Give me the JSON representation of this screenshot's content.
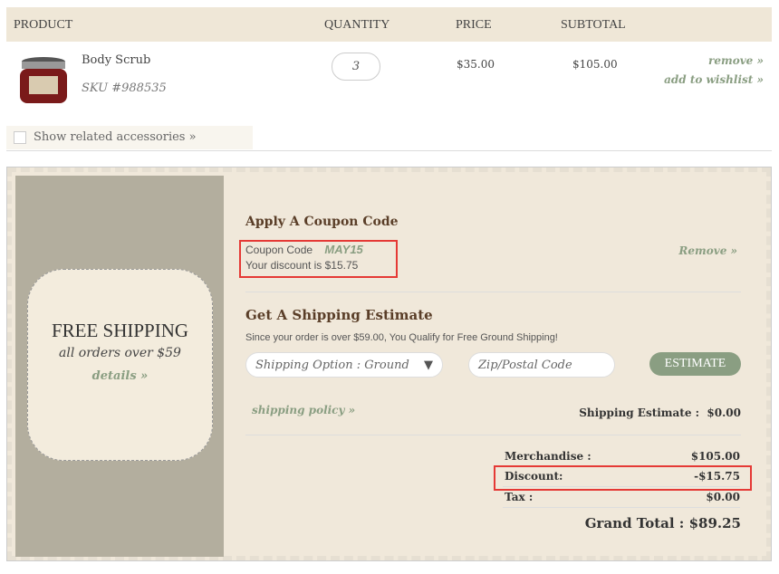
{
  "table": {
    "headers": {
      "product": "PRODUCT",
      "quantity": "QUANTITY",
      "price": "PRICE",
      "subtotal": "SUBTOTAL"
    }
  },
  "item": {
    "name": "Body Scrub",
    "sku": "SKU #988535",
    "quantity": "3",
    "price": "$35.00",
    "subtotal": "$105.00",
    "remove": "remove »",
    "wishlist": "add to wishlist »"
  },
  "accessories": {
    "label": "Show related accessories »",
    "checked": false
  },
  "promo": {
    "title": "FREE SHIPPING",
    "subtitle": "all orders over $59",
    "link": "details »"
  },
  "coupon": {
    "title": "Apply A Coupon Code",
    "label": "Coupon Code",
    "code": "MAY15",
    "discount_text": "Your discount is $15.75",
    "remove": "Remove »"
  },
  "shipping": {
    "title": "Get A Shipping Estimate",
    "note": "Since your order is over $59.00, You Qualify for Free Ground Shipping!",
    "option": "Shipping Option : Ground",
    "zip_placeholder": "Zip/Postal Code",
    "estimate_button": "ESTIMATE",
    "policy_link": "shipping policy »",
    "estimate_label": "Shipping Estimate :",
    "estimate_value": "$0.00"
  },
  "summary": {
    "merch_label": "Merchandise :",
    "merch_value": "$105.00",
    "discount_label": "Discount:",
    "discount_value": "-$15.75",
    "tax_label": "Tax :",
    "tax_value": "$0.00",
    "total_label": "Grand Total :",
    "total_value": "$89.25"
  },
  "colors": {
    "accent": "#8a9e82",
    "heading": "#5a3e28",
    "highlight": "#e53935"
  }
}
